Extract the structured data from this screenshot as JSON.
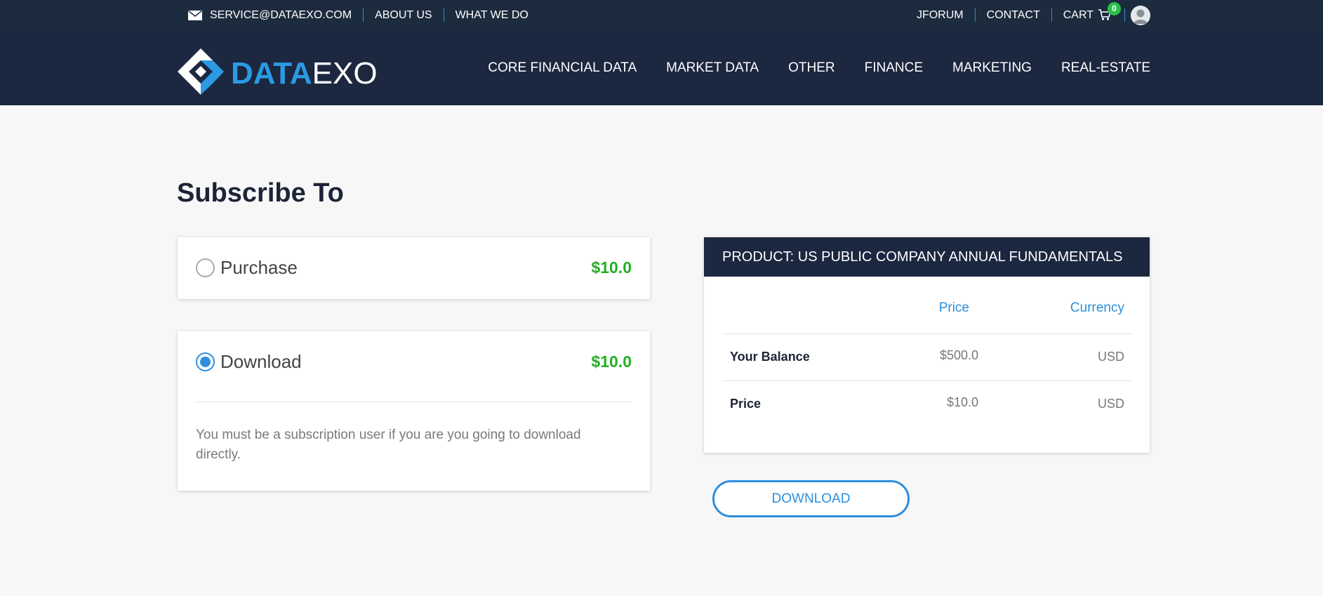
{
  "topbar": {
    "email": "SERVICE@DATAEXO.COM",
    "about": "ABOUT US",
    "what_we_do": "WHAT WE DO",
    "jforum": "JFORUM",
    "contact": "CONTACT",
    "cart": "CART",
    "cart_count": "0"
  },
  "brand": {
    "logo_part1": "DATA",
    "logo_part2": "EXO",
    "accent": "#2b9ae3",
    "nav_bg": "#1c2740"
  },
  "nav": {
    "items": [
      "CORE FINANCIAL DATA",
      "MARKET DATA",
      "OTHER",
      "FINANCE",
      "MARKETING",
      "REAL-ESTATE"
    ]
  },
  "page": {
    "title": "Subscribe To"
  },
  "options": {
    "purchase": {
      "label": "Purchase",
      "price": "$10.0",
      "selected": false
    },
    "download": {
      "label": "Download",
      "price": "$10.0",
      "selected": true,
      "note": "You must be a subscription user if you are you going to download directly."
    }
  },
  "product": {
    "header": "PRODUCT: US PUBLIC COMPANY ANNUAL FUNDAMENTALS",
    "col_price": "Price",
    "col_currency": "Currency",
    "rows": [
      {
        "label": "Your Balance",
        "price": "$500.0",
        "currency": "USD"
      },
      {
        "label": "Price",
        "price": "$10.0",
        "currency": "USD"
      }
    ]
  },
  "action": {
    "download_button": "DOWNLOAD"
  },
  "colors": {
    "price_green": "#22b022",
    "radio_blue": "#2d8fe0",
    "badge_green": "#29c04a"
  },
  "icons": {
    "mail": "envelope-icon",
    "cart": "shopping-cart-icon",
    "user": "user-avatar-icon",
    "logo": "dataexo-diamond-logo"
  }
}
